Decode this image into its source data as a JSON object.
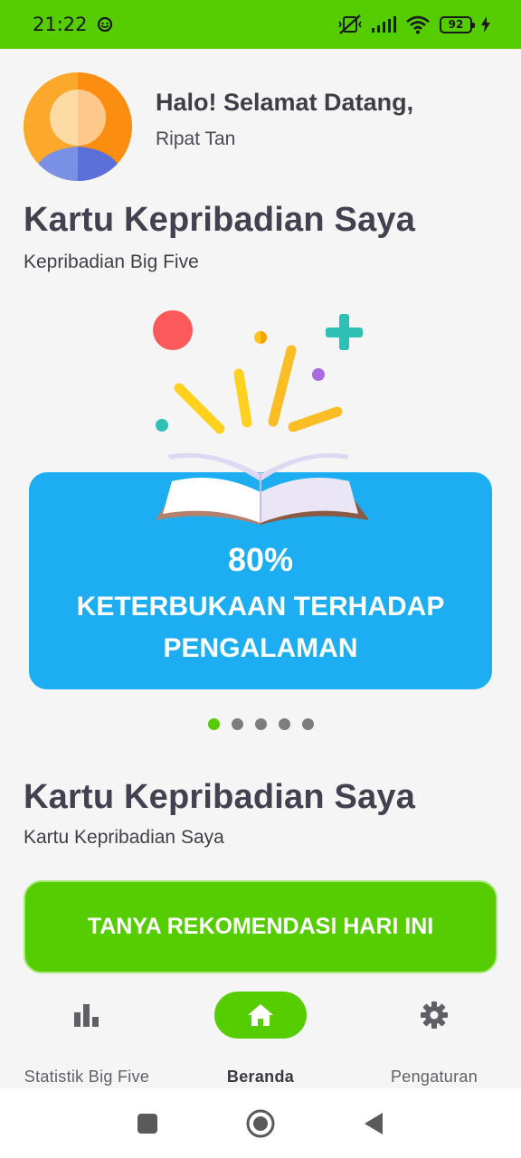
{
  "status_bar": {
    "time": "21:22",
    "battery": "92"
  },
  "greeting": {
    "title": "Halo! Selamat Datang,",
    "name": "Ripat Tan"
  },
  "section1": {
    "title": "Kartu Kepribadian Saya",
    "subtitle": "Kepribadian Big Five"
  },
  "card": {
    "percent": "80%",
    "label": "KETERBUKAAN TERHADAP PENGALAMAN"
  },
  "carousel": {
    "active_index": 0,
    "count": 5
  },
  "section2": {
    "title": "Kartu Kepribadian Saya",
    "subtitle": "Kartu Kepribadian Saya"
  },
  "cta": {
    "label": "TANYA REKOMENDASI HARI INI"
  },
  "bottom_nav": {
    "items": [
      {
        "label": "Statistik Big Five",
        "icon": "bar-chart-icon",
        "active": false
      },
      {
        "label": "Beranda",
        "icon": "home-icon",
        "active": true
      },
      {
        "label": "Pengaturan",
        "icon": "gear-icon",
        "active": false
      }
    ]
  },
  "colors": {
    "primary": "#56cc02",
    "card": "#1caef0",
    "text": "#414150"
  }
}
